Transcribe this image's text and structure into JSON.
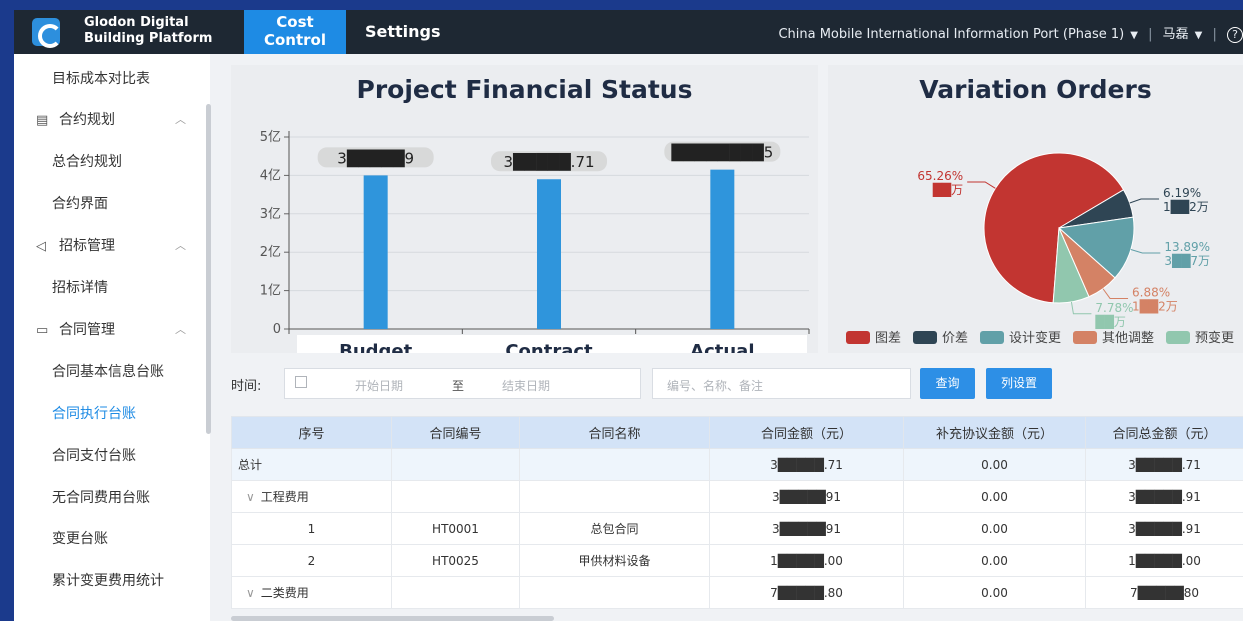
{
  "header": {
    "brand": "Glodon Digital Building Platform",
    "tabs": [
      {
        "label": "Cost Control",
        "active": true
      },
      {
        "label": "Settings",
        "active": false
      }
    ],
    "project": "China Mobile International Information Port (Phase 1)",
    "user": "马磊",
    "help": "?"
  },
  "sidebar": {
    "items": [
      {
        "label": "目标成本对比表",
        "type": "item"
      },
      {
        "label": "合约规划",
        "type": "group",
        "icon": "document-icon"
      },
      {
        "label": "总合约规划",
        "type": "item"
      },
      {
        "label": "合约界面",
        "type": "item"
      },
      {
        "label": "招标管理",
        "type": "group",
        "icon": "send-icon"
      },
      {
        "label": "招标详情",
        "type": "item"
      },
      {
        "label": "合同管理",
        "type": "group",
        "icon": "folder-icon"
      },
      {
        "label": "合同基本信息台账",
        "type": "item"
      },
      {
        "label": "合同执行台账",
        "type": "item",
        "active": true
      },
      {
        "label": "合同支付台账",
        "type": "item"
      },
      {
        "label": "无合同费用台账",
        "type": "item"
      },
      {
        "label": "变更台账",
        "type": "item"
      },
      {
        "label": "累计变更费用统计",
        "type": "item"
      }
    ]
  },
  "chart_data": [
    {
      "type": "bar",
      "title": "Project Financial Status",
      "categories": [
        "Budget",
        "Contract",
        "Actual"
      ],
      "values": [
        4.0,
        3.9,
        4.15
      ],
      "data_labels": [
        "3█████9",
        "3█████.71",
        "████████5"
      ],
      "y_tick_labels": [
        "0",
        "1亿",
        "2亿",
        "3亿",
        "4亿",
        "5亿"
      ],
      "ylim": [
        0,
        5
      ],
      "grid": true,
      "color": "#2f95dc"
    },
    {
      "type": "pie",
      "title": "Variation Orders",
      "slices": [
        {
          "name": "图差",
          "value": 65.26,
          "label_pct": "65.26%",
          "label_amt": "██万",
          "color": "#c23531"
        },
        {
          "name": "价差",
          "value": 6.19,
          "label_pct": "6.19%",
          "label_amt": "1██2万",
          "color": "#2f4554"
        },
        {
          "name": "设计变更",
          "value": 13.89,
          "label_pct": "13.89%",
          "label_amt": "3██7万",
          "color": "#61a0a8"
        },
        {
          "name": "其他调整",
          "value": 6.88,
          "label_pct": "6.88%",
          "label_amt": "1██2万",
          "color": "#d48265"
        },
        {
          "name": "预变更",
          "value": 7.78,
          "label_pct": "7.78%",
          "label_amt": "██万",
          "color": "#91c7ae"
        }
      ],
      "legend_position": "bottom"
    }
  ],
  "filter": {
    "label": "时间:",
    "start_placeholder": "开始日期",
    "to": "至",
    "end_placeholder": "结束日期",
    "search_placeholder": "编号、名称、备注",
    "query_button": "查询",
    "columns_button": "列设置"
  },
  "table": {
    "headers": [
      "序号",
      "合同编号",
      "合同名称",
      "合同金额（元）",
      "补充协议金额（元）",
      "合同总金额（元）"
    ],
    "rows": [
      {
        "index": "总计",
        "code": "",
        "name": "",
        "amount": "3█████.71",
        "supplement": "0.00",
        "total": "3█████.71",
        "kind": "total"
      },
      {
        "index": "工程费用",
        "code": "",
        "name": "",
        "amount": "3█████91",
        "supplement": "0.00",
        "total": "3█████.91",
        "kind": "group",
        "expand": "∨"
      },
      {
        "index": "1",
        "code": "HT0001",
        "name": "总包合同",
        "amount": "3█████91",
        "supplement": "0.00",
        "total": "3█████.91",
        "kind": "row"
      },
      {
        "index": "2",
        "code": "HT0025",
        "name": "甲供材料设备",
        "amount": "1█████.00",
        "supplement": "0.00",
        "total": "1█████.00",
        "kind": "row"
      },
      {
        "index": "二类费用",
        "code": "",
        "name": "",
        "amount": "7█████.80",
        "supplement": "0.00",
        "total": "7█████80",
        "kind": "group",
        "expand": "∨"
      }
    ]
  }
}
